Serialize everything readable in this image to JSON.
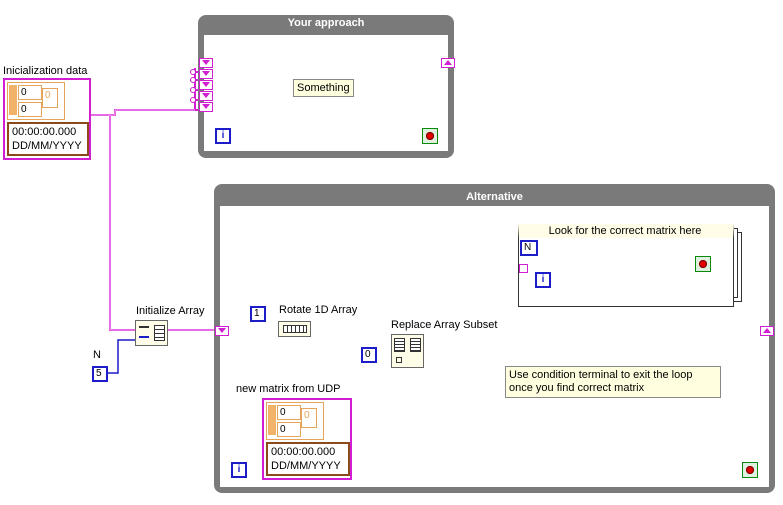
{
  "loops": {
    "approach": {
      "title": "Your approach",
      "iter_label": "i"
    },
    "alternative": {
      "title": "Alternative",
      "iter_label": "i"
    },
    "inner": {
      "title": "Look for the correct  matrix here",
      "iter_label": "i",
      "n_label": "N"
    }
  },
  "tags": {
    "something": "Something"
  },
  "init_data": {
    "label": "Inicialization data",
    "field1": "0",
    "field2": "0",
    "field3": "0",
    "time": "00:00:00.000",
    "date": "DD/MM/YYYY"
  },
  "new_matrix": {
    "label": "new matrix from UDP",
    "field1": "0",
    "field2": "0",
    "field3": "0",
    "time": "00:00:00.000",
    "date": "DD/MM/YYYY"
  },
  "functions": {
    "initialize_array": "Initialize Array",
    "rotate": "Rotate 1D Array",
    "replace": "Replace Array Subset"
  },
  "constants": {
    "n_label": "N",
    "n_value": "5",
    "rotate_value": "1",
    "index_value": "0"
  },
  "callout": {
    "text": "Use condition terminal to exit the loop once you find correct matrix"
  },
  "colors": {
    "cluster_wire": "#d21ed2",
    "int_wire": "#1c1cc8",
    "loop_frame": "#7a7a7a"
  }
}
